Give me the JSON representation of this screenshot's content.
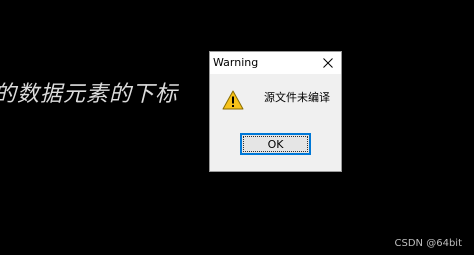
{
  "background": {
    "text": "的数据元素的下标",
    "watermark": "CSDN @64bit"
  },
  "dialog": {
    "title": "Warning",
    "message": "源文件未编译",
    "ok_label": "OK",
    "close_icon": "close-icon",
    "message_icon": "warning-icon",
    "colors": {
      "button_border": "#0078d7",
      "warning_fill": "#f7c21a"
    }
  }
}
